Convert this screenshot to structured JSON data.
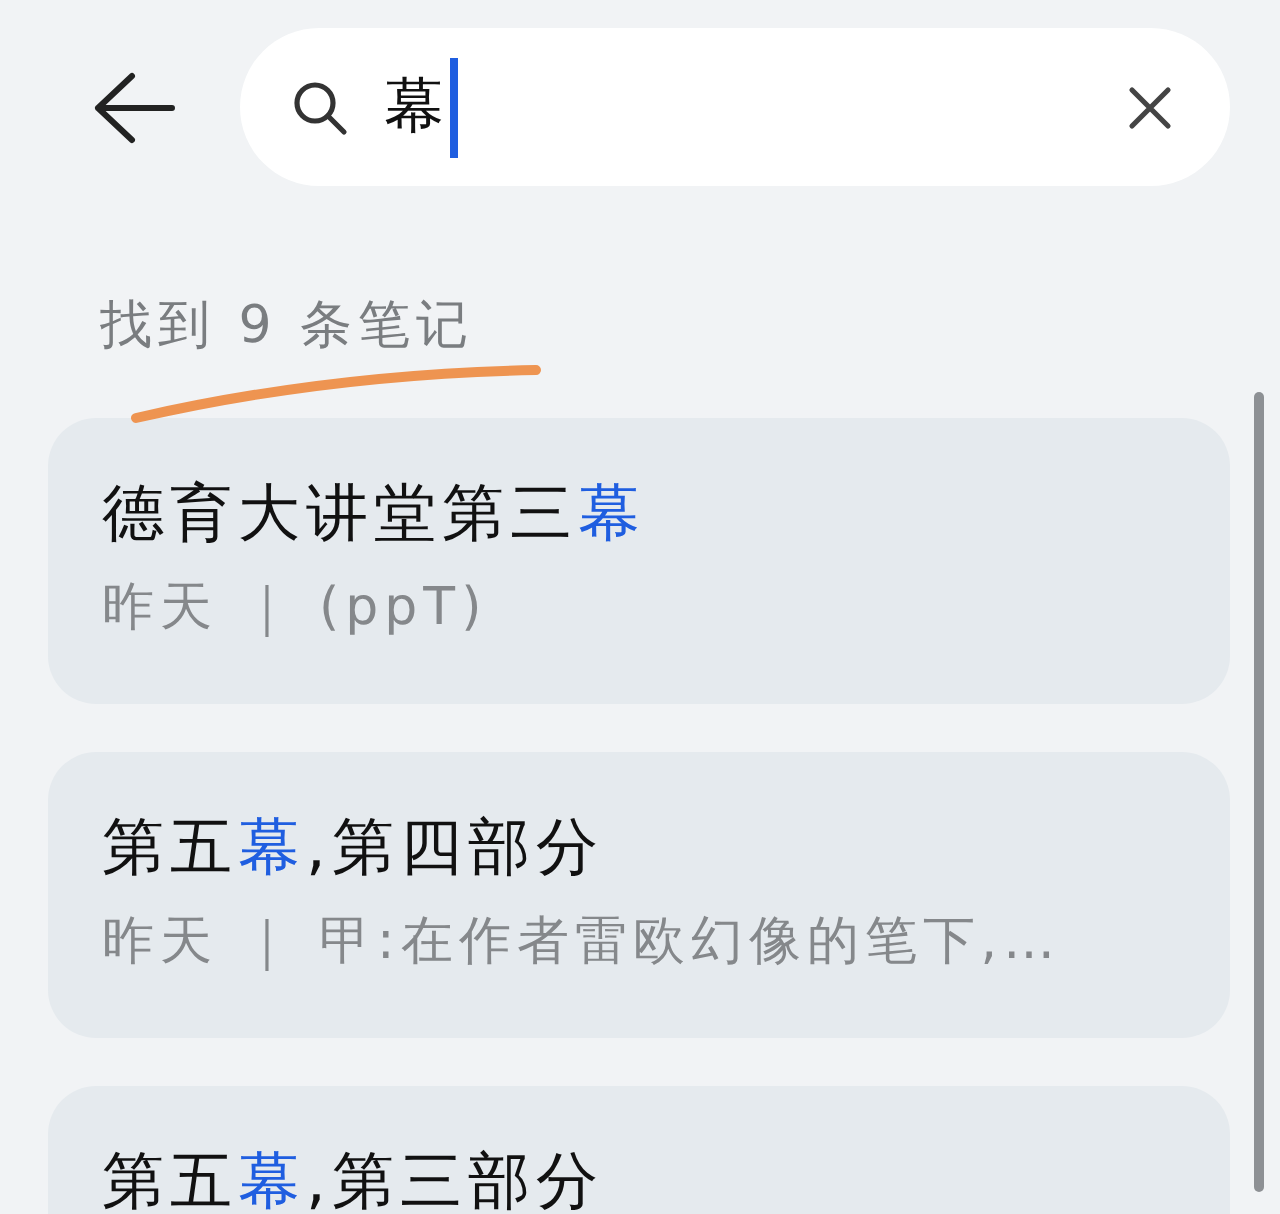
{
  "search": {
    "value": "幕"
  },
  "result_count": "找到 9 条笔记",
  "notes": [
    {
      "title": [
        {
          "text": "德育大讲堂第三",
          "match": false
        },
        {
          "text": "幕",
          "match": true
        }
      ],
      "subtitle": "昨天 ｜ (ppT)"
    },
    {
      "title": [
        {
          "text": "第五",
          "match": false
        },
        {
          "text": "幕",
          "match": true
        },
        {
          "text": ",第四部分",
          "match": false
        }
      ],
      "subtitle": "昨天 ｜ 甲:在作者雷欧幻像的笔下,…"
    },
    {
      "title": [
        {
          "text": "第五",
          "match": false
        },
        {
          "text": "幕",
          "match": true
        },
        {
          "text": ",第三部分",
          "match": false
        }
      ]
    }
  ]
}
